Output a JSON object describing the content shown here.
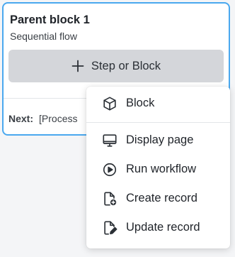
{
  "block": {
    "title": "Parent block 1",
    "subtitle": "Sequential flow",
    "add_button_label": "Step or Block",
    "next_label": "Next:",
    "next_value": "[Process"
  },
  "menu": {
    "items": [
      {
        "label": "Block",
        "icon": "cube-icon"
      },
      {
        "label": "Display page",
        "icon": "monitor-icon"
      },
      {
        "label": "Run workflow",
        "icon": "play-circle-icon"
      },
      {
        "label": "Create record",
        "icon": "file-plus-icon"
      },
      {
        "label": "Update record",
        "icon": "file-edit-icon"
      }
    ]
  },
  "colors": {
    "card_border": "#4aa8ef",
    "button_bg": "#d4d6da",
    "page_bg": "#f4f5f7"
  }
}
